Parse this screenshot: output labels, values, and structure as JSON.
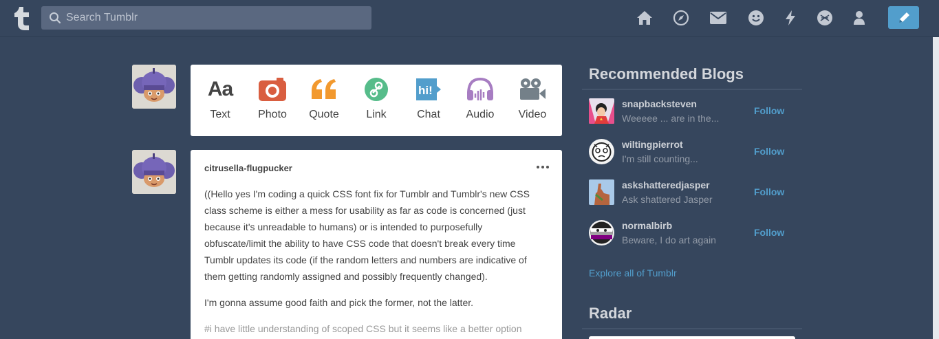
{
  "search": {
    "placeholder": "Search Tumblr"
  },
  "nav": {
    "icons": [
      "home-icon",
      "explore-compass-icon",
      "inbox-mail-icon",
      "messaging-smile-icon",
      "activity-bolt-icon",
      "xkit-icon",
      "account-icon",
      "compose-pencil-icon"
    ]
  },
  "post_types": [
    {
      "label": "Text",
      "icon": "text-icon",
      "color": "#444444"
    },
    {
      "label": "Photo",
      "icon": "camera-icon",
      "color": "#d95e40"
    },
    {
      "label": "Quote",
      "icon": "quote-icon",
      "color": "#f2992e"
    },
    {
      "label": "Link",
      "icon": "link-icon",
      "color": "#56bc8a"
    },
    {
      "label": "Chat",
      "icon": "chat-icon",
      "color": "#529ecc"
    },
    {
      "label": "Audio",
      "icon": "audio-icon",
      "color": "#a77dc2"
    },
    {
      "label": "Video",
      "icon": "video-icon",
      "color": "#748089"
    }
  ],
  "post": {
    "author": "citrusella-flugpucker",
    "paragraphs": [
      "((Hello yes I'm coding a quick CSS font fix for Tumblr and Tumblr's new CSS class scheme is either a mess for usability as far as code is concerned (just because it's unreadable to humans) or is intended to purposefully obfuscate/limit the ability to have CSS code that doesn't break every time Tumblr updates its code (if the random letters and numbers are indicative of them getting randomly assigned and possibly frequently changed).",
      "I'm gonna assume good faith and pick the former, not the latter."
    ],
    "tags": "#i have little understanding of scoped CSS but it seems like a better option"
  },
  "sidebar": {
    "recommended_title": "Recommended Blogs",
    "blogs": [
      {
        "name": "snapbacksteven",
        "desc": "Weeeee ... are in the...",
        "follow": "Follow"
      },
      {
        "name": "wiltingpierrot",
        "desc": "I'm still counting...",
        "follow": "Follow"
      },
      {
        "name": "askshatteredjasper",
        "desc": "Ask shattered Jasper",
        "follow": "Follow"
      },
      {
        "name": "normalbirb",
        "desc": "Beware, I do art again",
        "follow": "Follow"
      }
    ],
    "explore_link": "Explore all of Tumblr",
    "radar_title": "Radar"
  },
  "colors": {
    "background": "#36465d",
    "accent": "#529ecc"
  }
}
